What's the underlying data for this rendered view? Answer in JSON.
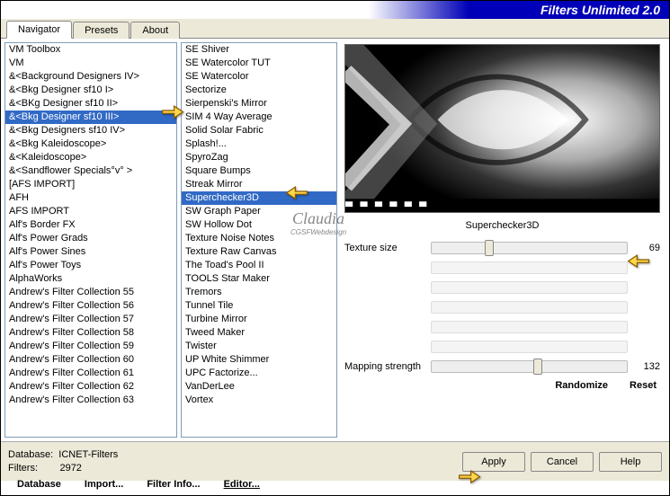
{
  "title": "Filters Unlimited 2.0",
  "tabs": [
    "Navigator",
    "Presets",
    "About"
  ],
  "active_tab": 0,
  "col1": [
    "VM Toolbox",
    "VM",
    "&<Background Designers IV>",
    "&<Bkg Designer sf10 I>",
    "&<BKg Designer sf10 II>",
    "&<Bkg Designer sf10 III>",
    "&<Bkg Designers sf10 IV>",
    "&<Bkg Kaleidoscope>",
    "&<Kaleidoscope>",
    "&<Sandflower Specials°v° >",
    "[AFS IMPORT]",
    "AFH",
    "AFS IMPORT",
    "Alf's Border FX",
    "Alf's Power Grads",
    "Alf's Power Sines",
    "Alf's Power Toys",
    "AlphaWorks",
    "Andrew's Filter Collection 55",
    "Andrew's Filter Collection 56",
    "Andrew's Filter Collection 57",
    "Andrew's Filter Collection 58",
    "Andrew's Filter Collection 59",
    "Andrew's Filter Collection 60",
    "Andrew's Filter Collection 61",
    "Andrew's Filter Collection 62",
    "Andrew's Filter Collection 63"
  ],
  "col1_selected": 5,
  "col2": [
    "SE Shiver",
    "SE Watercolor TUT",
    "SE Watercolor",
    "Sectorize",
    "Sierpenski's Mirror",
    "SIM 4 Way Average",
    "Solid Solar Fabric",
    "Splash!...",
    "SpyroZag",
    "Square Bumps",
    "Streak Mirror",
    "Superchecker3D",
    "SW Graph Paper",
    "SW Hollow Dot",
    "Texture Noise Notes",
    "Texture Raw Canvas",
    "The Toad's Pool II",
    "TOOLS Star Maker",
    "Tremors",
    "Tunnel Tile",
    "Turbine Mirror",
    "Tweed Maker",
    "Twister",
    "UP White Shimmer",
    "UPC Factorize...",
    "VanDerLee",
    "Vortex"
  ],
  "col2_selected": 11,
  "preview_label": "Superchecker3D",
  "watermark": {
    "name": "Claudia",
    "sub": "CGSFWebdesign"
  },
  "param1": {
    "label": "Texture size",
    "value": 69,
    "pct": 27
  },
  "param2": {
    "label": "Mapping strength",
    "value": 132,
    "pct": 52
  },
  "randomize": "Randomize",
  "reset": "Reset",
  "bottom_buttons": {
    "database": "Database",
    "import": "Import...",
    "filter_info": "Filter Info...",
    "editor": "Editor..."
  },
  "status": {
    "db_label": "Database:",
    "db_value": "ICNET-Filters",
    "filters_label": "Filters:",
    "filters_value": "2972"
  },
  "footer_buttons": {
    "apply": "Apply",
    "cancel": "Cancel",
    "help": "Help"
  }
}
